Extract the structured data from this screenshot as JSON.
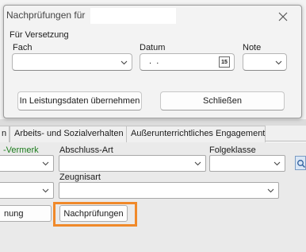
{
  "dialog": {
    "title": "Nachprüfungen für",
    "section_label": "Für Versetzung",
    "fach_label": "Fach",
    "datum_label": "Datum",
    "datum_value": " .  .",
    "calendar_glyph": "15",
    "note_label": "Note",
    "uebernehmen_button": "In Leistungsdaten übernehmen",
    "schliessen_button": "Schließen"
  },
  "tabs": [
    {
      "label": "n"
    },
    {
      "label": "Arbeits- und Sozialverhalten"
    },
    {
      "label": "Außerunterrichtliches Engagement"
    }
  ],
  "panel": {
    "vermerk_label": "-Vermerk",
    "abschluss_label": "Abschluss-Art",
    "folgeklasse_label": "Folgeklasse",
    "zeugnisart_label": "Zeugnisart",
    "left_button": "nung",
    "nachpruefungen_button": "Nachprüfungen"
  },
  "colors": {
    "highlight": "#f0892a",
    "vermerk_text": "#1d7d1d"
  }
}
